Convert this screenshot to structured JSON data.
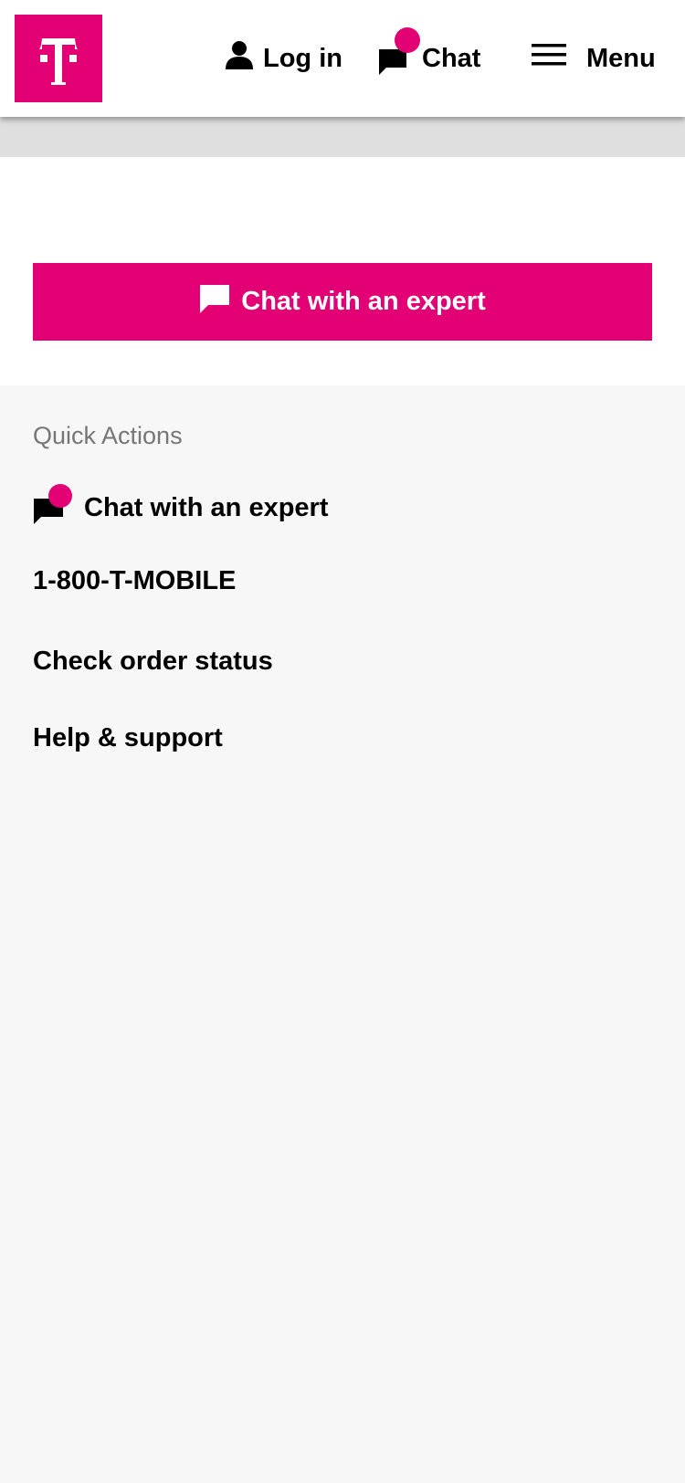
{
  "header": {
    "login_label": "Log in",
    "chat_label": "Chat",
    "menu_label": "Menu"
  },
  "cta": {
    "label": "Chat with an expert"
  },
  "quick_actions": {
    "heading": "Quick Actions",
    "items": [
      {
        "label": "Chat with an expert",
        "icon": "chat-notification-icon"
      },
      {
        "label": "1-800-T-MOBILE"
      },
      {
        "label": "Check order status"
      },
      {
        "label": "Help & support"
      }
    ]
  },
  "colors": {
    "brand": "#e20074",
    "page_bg": "#f7f7f7",
    "band_grey": "#dfdfdf",
    "muted_text": "#767676",
    "text": "#000000"
  }
}
